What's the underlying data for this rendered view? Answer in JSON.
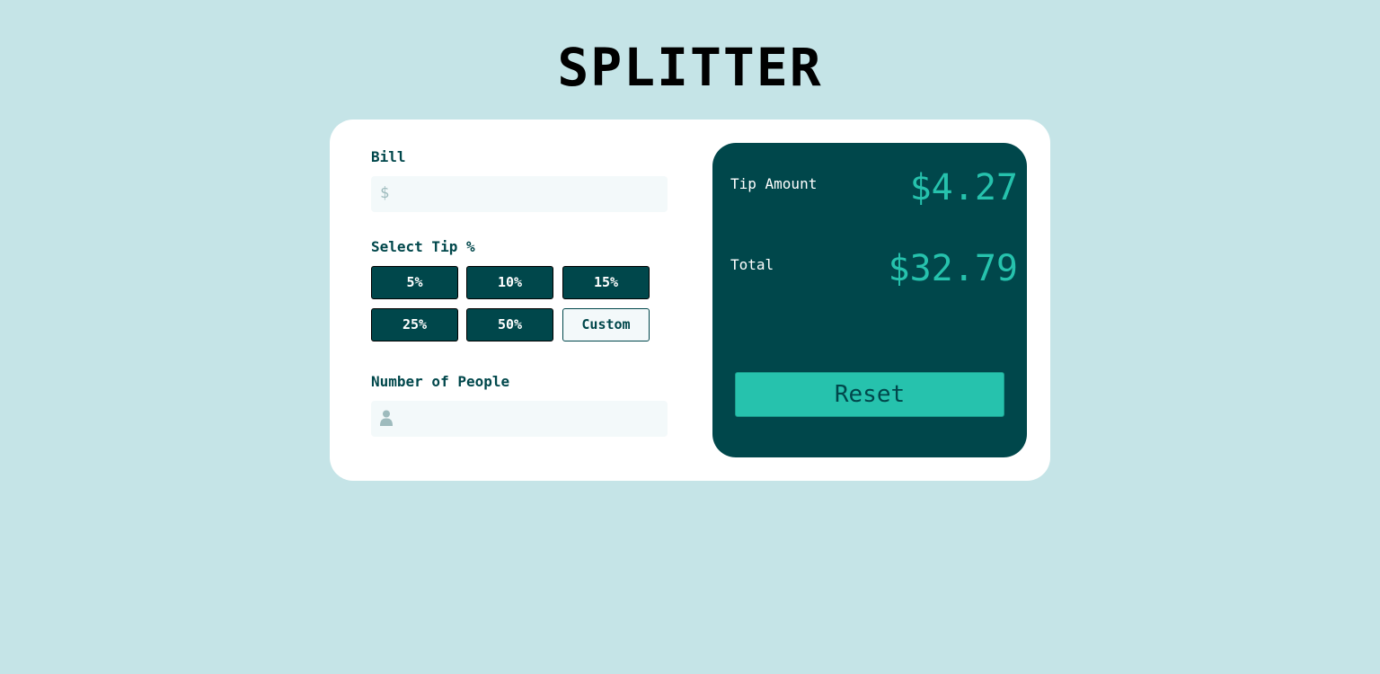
{
  "app": {
    "title": "SPLITTER"
  },
  "bill": {
    "label": "Bill",
    "currency_symbol": "$",
    "value": ""
  },
  "tip": {
    "label": "Select Tip %",
    "options": [
      "5%",
      "10%",
      "15%",
      "25%",
      "50%"
    ],
    "custom_label": "Custom"
  },
  "people": {
    "label": "Number of People",
    "icon": "person-icon",
    "value": ""
  },
  "results": {
    "tip_amount_label": "Tip Amount",
    "tip_amount_value": "$4.27",
    "total_label": "Total",
    "total_value": "$32.79",
    "reset_label": "Reset"
  },
  "colors": {
    "background": "#c5e4e7",
    "dark_teal": "#00474b",
    "accent": "#26c2ad",
    "input_bg": "#f3f9fa"
  }
}
